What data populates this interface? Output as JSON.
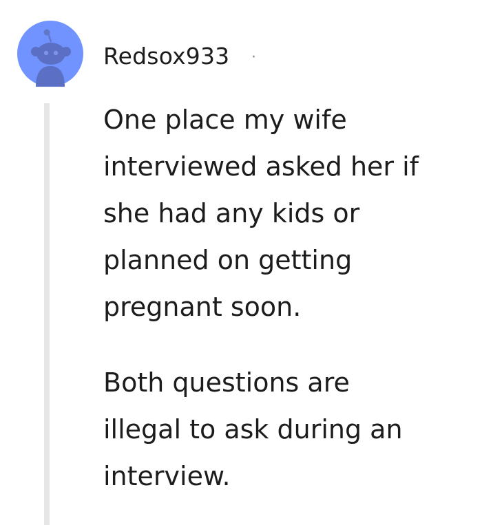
{
  "comment": {
    "username": "Redsox933",
    "separator": "·",
    "avatar_icon": "snoo-avatar-icon",
    "avatar_color": "#7193ff",
    "paragraphs": [
      "One place my wife\ninterviewed asked her if\nshe had any kids or\nplanned on getting\npregnant soon.",
      "Both questions are\nillegal to ask during an\ninterview."
    ]
  }
}
